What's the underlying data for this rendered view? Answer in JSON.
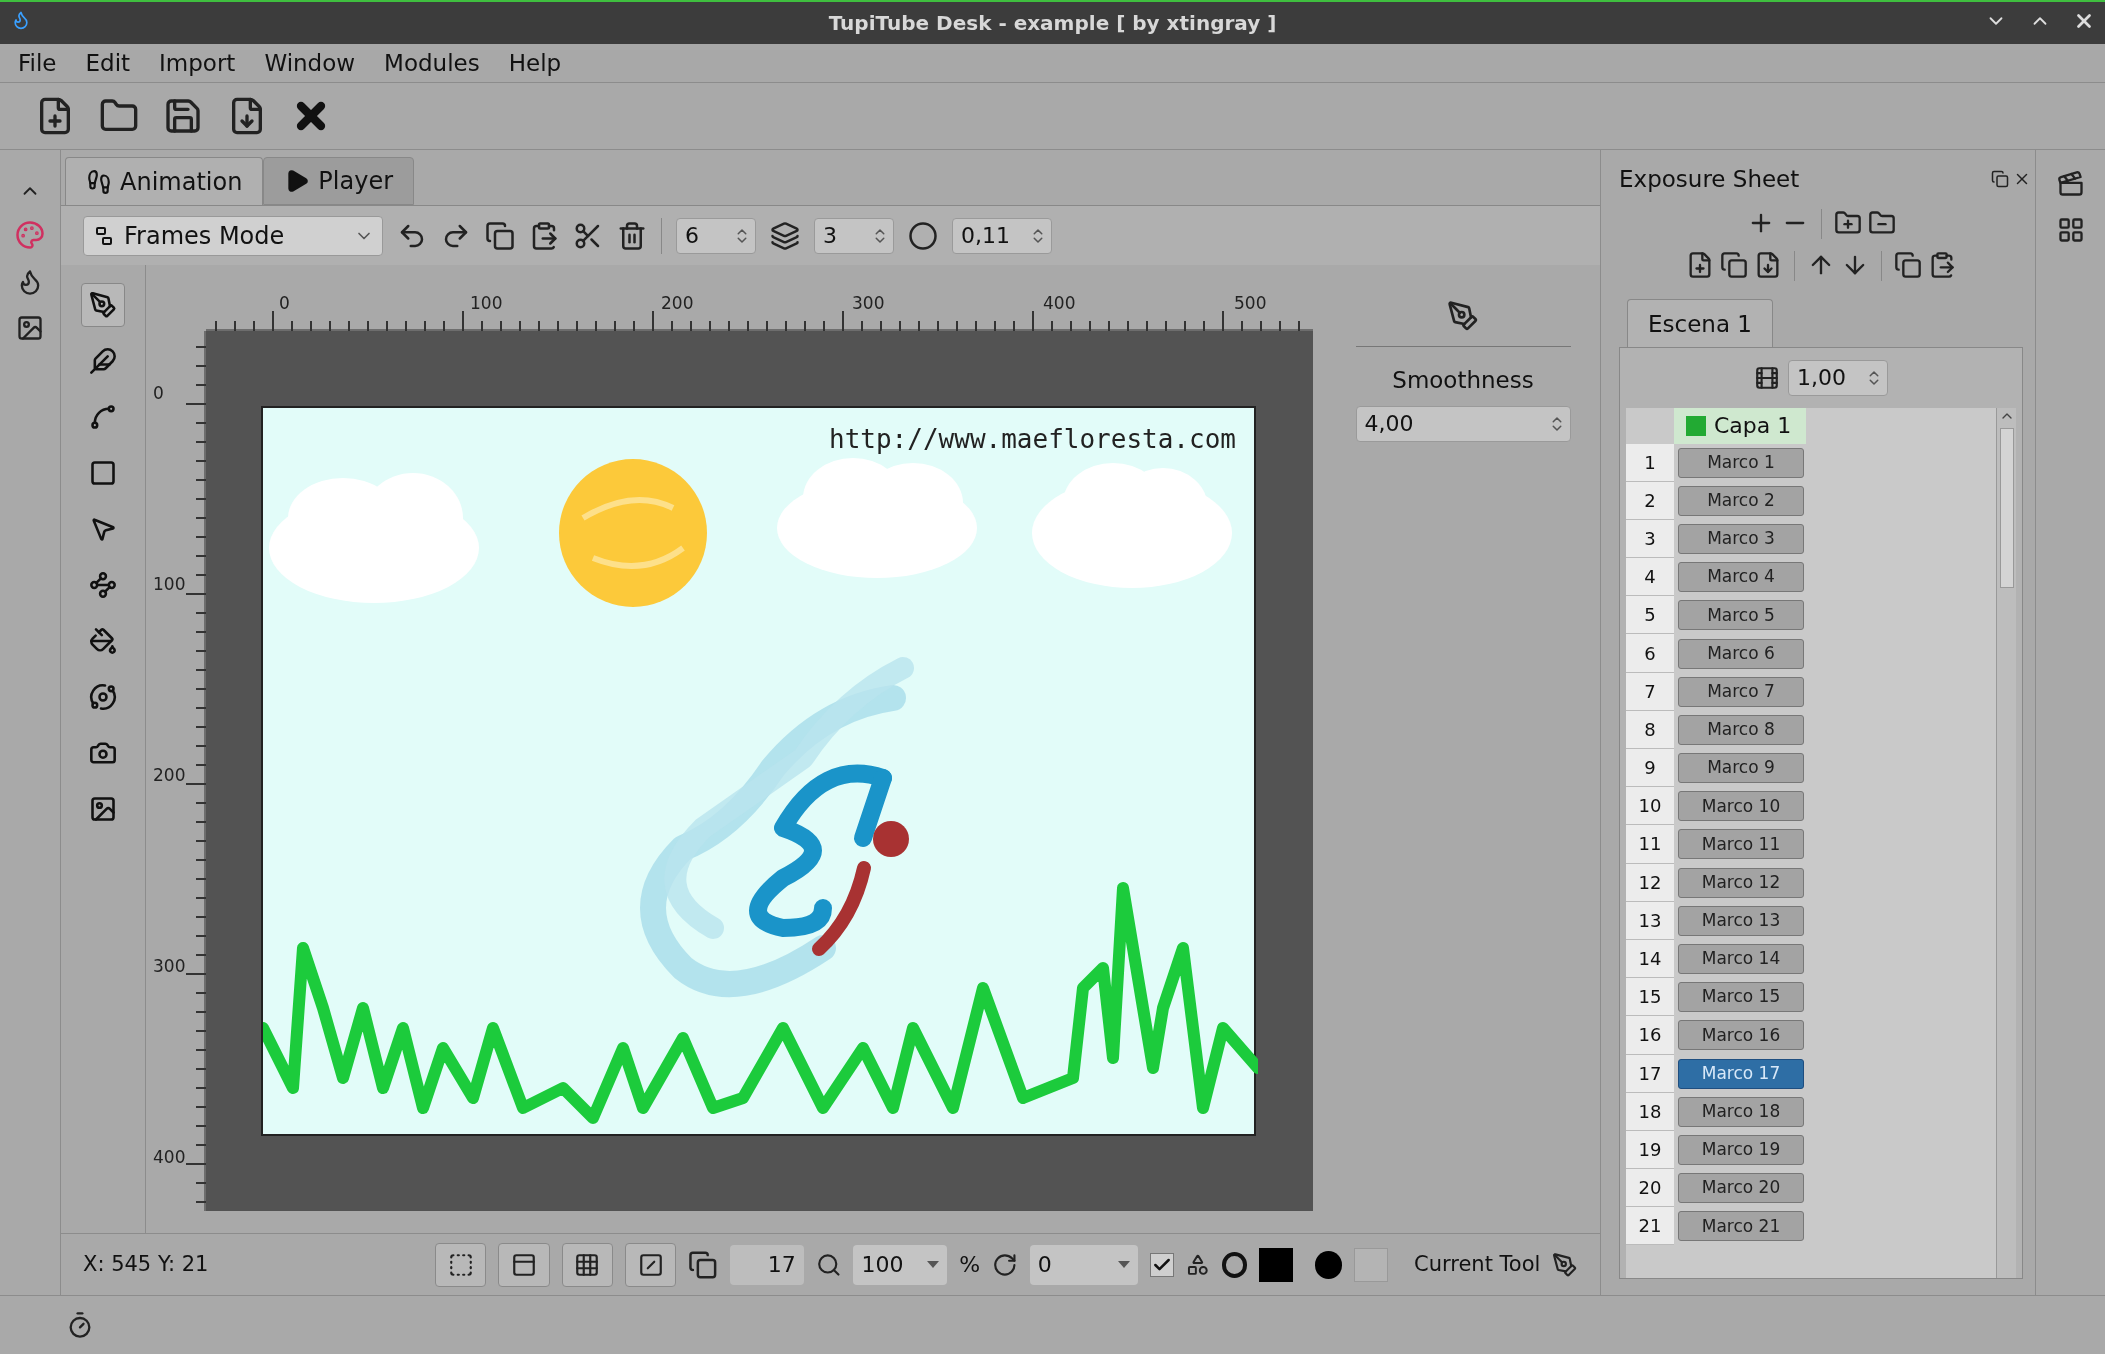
{
  "window": {
    "title": "TupiTube Desk - example [ by xtingray ]"
  },
  "menu": [
    "File",
    "Edit",
    "Import",
    "Window",
    "Modules",
    "Help"
  ],
  "tabs": [
    {
      "label": "Animation",
      "kind": "animation",
      "selected": true
    },
    {
      "label": "Player",
      "kind": "player",
      "selected": false
    }
  ],
  "frame_toolbar": {
    "mode": "Frames Mode",
    "onion_previous": "6",
    "onion_next": "3",
    "opacity": "0,11"
  },
  "tools": [
    {
      "kind": "pencil",
      "selected": true
    },
    {
      "kind": "ink",
      "selected": false
    },
    {
      "kind": "polyline",
      "selected": false
    },
    {
      "kind": "rectangle",
      "selected": false
    },
    {
      "kind": "select",
      "selected": false
    },
    {
      "kind": "node",
      "selected": false
    },
    {
      "kind": "fill",
      "selected": false
    },
    {
      "kind": "tween",
      "selected": false
    },
    {
      "kind": "camera",
      "selected": false
    },
    {
      "kind": "image",
      "selected": false
    }
  ],
  "ruler": {
    "horizontal": [
      "0",
      "100",
      "200",
      "300",
      "400",
      "500"
    ],
    "vertical": [
      "0",
      "100",
      "200",
      "300",
      "400"
    ]
  },
  "canvas": {
    "caption": "http://www.maefloresta.com"
  },
  "tool_panel": {
    "label": "Smoothness",
    "value": "4,00"
  },
  "status": {
    "coords": "X: 545 Y: 21",
    "frame": "17",
    "zoom": "100",
    "zoom_unit": "%",
    "rotation": "0",
    "onion_checked": true,
    "current_tool": "Current Tool"
  },
  "exposure": {
    "title": "Exposure Sheet",
    "scene": "Escena 1",
    "fps": "1,00",
    "layer": "Capa 1",
    "frames": [
      {
        "num": "1",
        "label": "Marco 1",
        "selected": false
      },
      {
        "num": "2",
        "label": "Marco 2",
        "selected": false
      },
      {
        "num": "3",
        "label": "Marco 3",
        "selected": false
      },
      {
        "num": "4",
        "label": "Marco 4",
        "selected": false
      },
      {
        "num": "5",
        "label": "Marco 5",
        "selected": false
      },
      {
        "num": "6",
        "label": "Marco 6",
        "selected": false
      },
      {
        "num": "7",
        "label": "Marco 7",
        "selected": false
      },
      {
        "num": "8",
        "label": "Marco 8",
        "selected": false
      },
      {
        "num": "9",
        "label": "Marco 9",
        "selected": false
      },
      {
        "num": "10",
        "label": "Marco 10",
        "selected": false
      },
      {
        "num": "11",
        "label": "Marco 11",
        "selected": false
      },
      {
        "num": "12",
        "label": "Marco 12",
        "selected": false
      },
      {
        "num": "13",
        "label": "Marco 13",
        "selected": false
      },
      {
        "num": "14",
        "label": "Marco 14",
        "selected": false
      },
      {
        "num": "15",
        "label": "Marco 15",
        "selected": false
      },
      {
        "num": "16",
        "label": "Marco 16",
        "selected": false
      },
      {
        "num": "17",
        "label": "Marco 17",
        "selected": true
      },
      {
        "num": "18",
        "label": "Marco 18",
        "selected": false
      },
      {
        "num": "19",
        "label": "Marco 19",
        "selected": false
      },
      {
        "num": "20",
        "label": "Marco 20",
        "selected": false
      },
      {
        "num": "21",
        "label": "Marco 21",
        "selected": false
      }
    ]
  }
}
